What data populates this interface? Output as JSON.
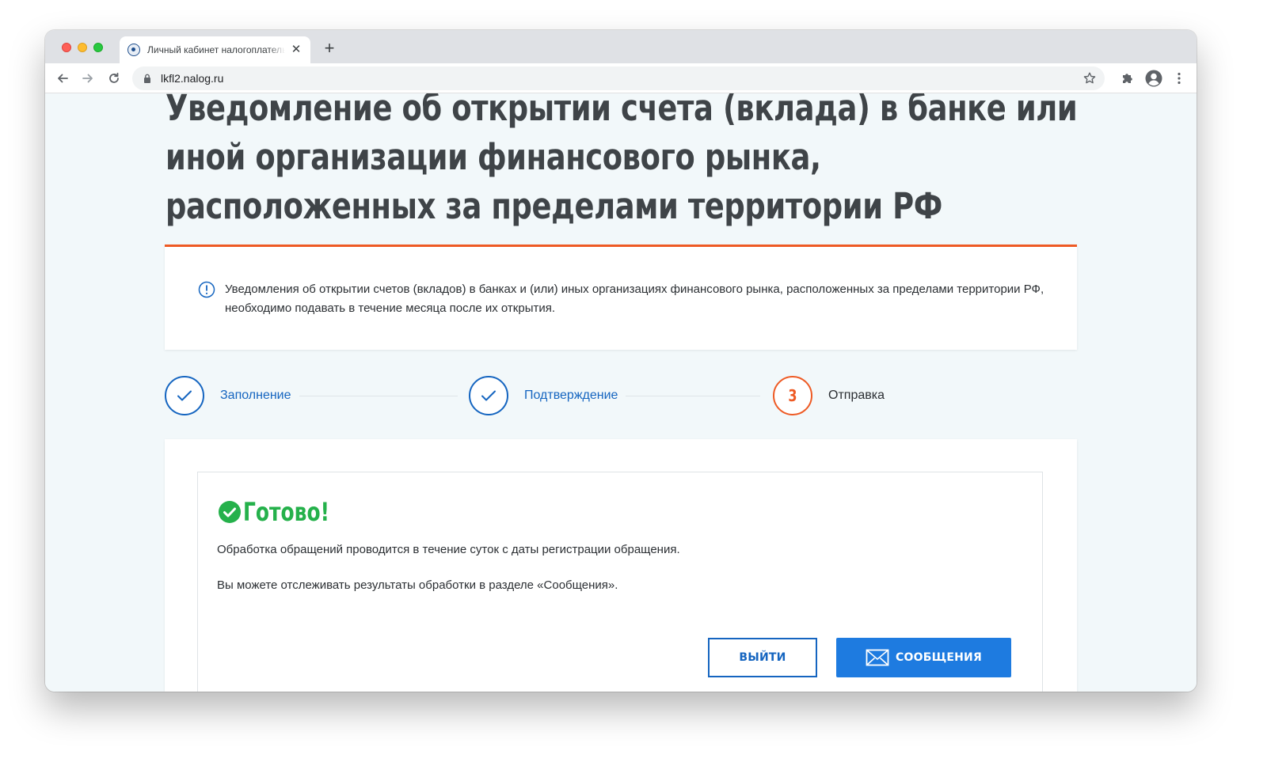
{
  "browser": {
    "tab": {
      "title": "Личный кабинет налогоплательщика"
    },
    "address": {
      "url": "lkfl2.nalog.ru"
    }
  },
  "page": {
    "title": "Уведомление об открытии счета (вклада) в банке или иной организации финансового рынка, расположенных за пределами территории РФ",
    "notice": "Уведомления об открытии счетов (вкладов) в банках и (или) иных организациях финансового рынка, расположенных за пределами территории РФ, необходимо подавать в течение месяца после их открытия.",
    "steps": [
      {
        "label": "Заполнение",
        "state": "done"
      },
      {
        "label": "Подтверждение",
        "state": "done"
      },
      {
        "label": "Отправка",
        "state": "current",
        "number": "3"
      }
    ],
    "result": {
      "title": "Готово!",
      "message_1": "Обработка обращений проводится в течение суток с даты регистрации обращения.",
      "message_2": "Вы можете отслеживать результаты обработки в разделе «Сообщения»."
    },
    "buttons": {
      "exit": "ВЫЙТИ",
      "messages": "СООБЩЕНИЯ"
    }
  },
  "colors": {
    "accent": "#1565c0",
    "primary_button": "#1e7be0",
    "current_step": "#ee5a24",
    "success": "#25b14b"
  },
  "icons": [
    "back-arrow-icon",
    "forward-arrow-icon",
    "reload-icon",
    "lock-icon",
    "star-icon",
    "puzzle-icon",
    "profile-icon",
    "kebab-menu-icon",
    "info-icon",
    "check-icon",
    "success-check-icon",
    "envelope-icon"
  ]
}
